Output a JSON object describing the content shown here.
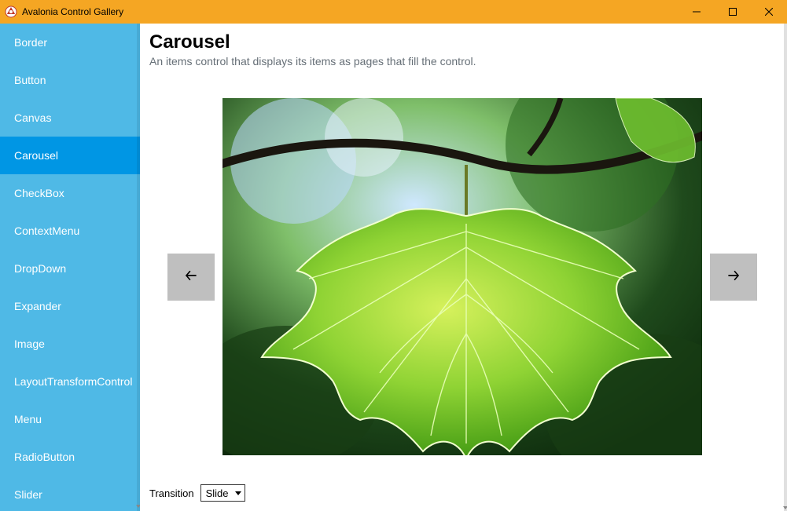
{
  "window": {
    "title": "Avalonia Control Gallery"
  },
  "sidebar": {
    "items": [
      {
        "label": "Border"
      },
      {
        "label": "Button"
      },
      {
        "label": "Canvas"
      },
      {
        "label": "Carousel"
      },
      {
        "label": "CheckBox"
      },
      {
        "label": "ContextMenu"
      },
      {
        "label": "DropDown"
      },
      {
        "label": "Expander"
      },
      {
        "label": "Image"
      },
      {
        "label": "LayoutTransformControl"
      },
      {
        "label": "Menu"
      },
      {
        "label": "RadioButton"
      },
      {
        "label": "Slider"
      }
    ],
    "selected_index": 3
  },
  "page": {
    "title": "Carousel",
    "description": "An items control that displays its items as pages that fill the control."
  },
  "carousel": {
    "image_description": "green maple leaf",
    "prev_icon": "arrow-left",
    "next_icon": "arrow-right"
  },
  "transition": {
    "label": "Transition",
    "selected": "Slide"
  }
}
